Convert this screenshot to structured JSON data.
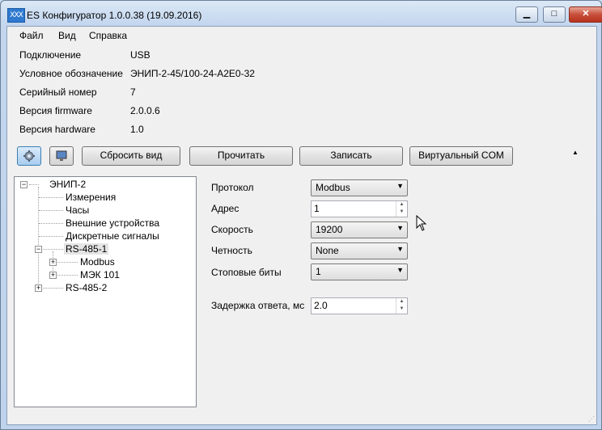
{
  "window": {
    "title": "ES Конфигуратор 1.0.0.38 (19.09.2016)",
    "icon": "app-logo-icon"
  },
  "menu": [
    "Файл",
    "Вид",
    "Справка"
  ],
  "info": [
    {
      "label": "Подключение",
      "value": "USB"
    },
    {
      "label": "Условное обозначение",
      "value": "ЭНИП-2-45/100-24-А2Е0-32"
    },
    {
      "label": "Серийный номер",
      "value": "7"
    },
    {
      "label": "Версия firmware",
      "value": "2.0.0.6"
    },
    {
      "label": "Версия hardware",
      "value": "1.0"
    }
  ],
  "toolbar": {
    "settings_icon": "gear-icon",
    "monitor_icon": "monitor-icon",
    "reset_view": "Сбросить вид",
    "read": "Прочитать",
    "write": "Записать",
    "virtual_com": "Виртуальный COM",
    "collapse": "▲"
  },
  "tree": {
    "root": "ЭНИП-2",
    "items": [
      "Измерения",
      "Часы",
      "Внешние устройства",
      "Дискретные сигналы",
      "RS-485-1",
      "Modbus",
      "МЭК 101",
      "RS-485-2"
    ],
    "selected": "RS-485-1"
  },
  "form": {
    "protocol_label": "Протокол",
    "protocol_value": "Modbus",
    "address_label": "Адрес",
    "address_value": "1",
    "speed_label": "Скорость",
    "speed_value": "19200",
    "parity_label": "Четность",
    "parity_value": "None",
    "stopbits_label": "Стоповые биты",
    "stopbits_value": "1",
    "delay_label": "Задержка ответа, мс",
    "delay_value": "2.0"
  }
}
